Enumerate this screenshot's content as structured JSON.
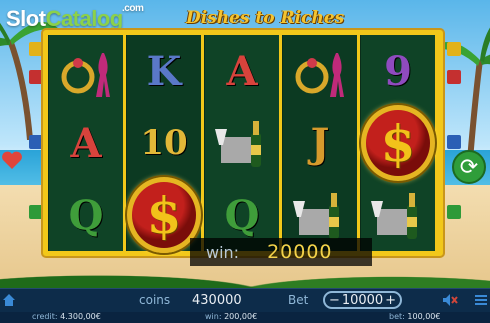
{
  "brand": {
    "slot": "Slot",
    "catalog": "Catalog",
    "com": ".com"
  },
  "game_title": "Dishes to Riches",
  "reels": [
    [
      "ring-perfume-symbol",
      "A",
      "Q"
    ],
    [
      "K",
      "10",
      "dollar-coin-symbol"
    ],
    [
      "A",
      "champagne-symbol",
      "Q"
    ],
    [
      "ring-perfume-symbol",
      "J",
      "champagne-symbol"
    ],
    [
      "9",
      "dollar-coin-symbol",
      "champagne-symbol"
    ]
  ],
  "win": {
    "label": "win:",
    "value": "20000"
  },
  "bottom_bar": {
    "coins_label": "coins",
    "coins_value": "430000",
    "bet_label": "Bet",
    "bet_value": "10000",
    "bet_minus": "−",
    "bet_plus": "+"
  },
  "footer": {
    "credit_label": "credit:",
    "credit_value": "4.300,00€",
    "win_label": "win:",
    "win_value": "200,00€",
    "bet_label": "bet:",
    "bet_value": "100,00€"
  },
  "colors": {
    "frame": "#f2c81a",
    "reel_bg": "#0c3a22",
    "win_value": "#f3d24a"
  },
  "icons": [
    "home-icon",
    "sound-icon",
    "menu-icon",
    "heart-icon",
    "reload-icon"
  ]
}
